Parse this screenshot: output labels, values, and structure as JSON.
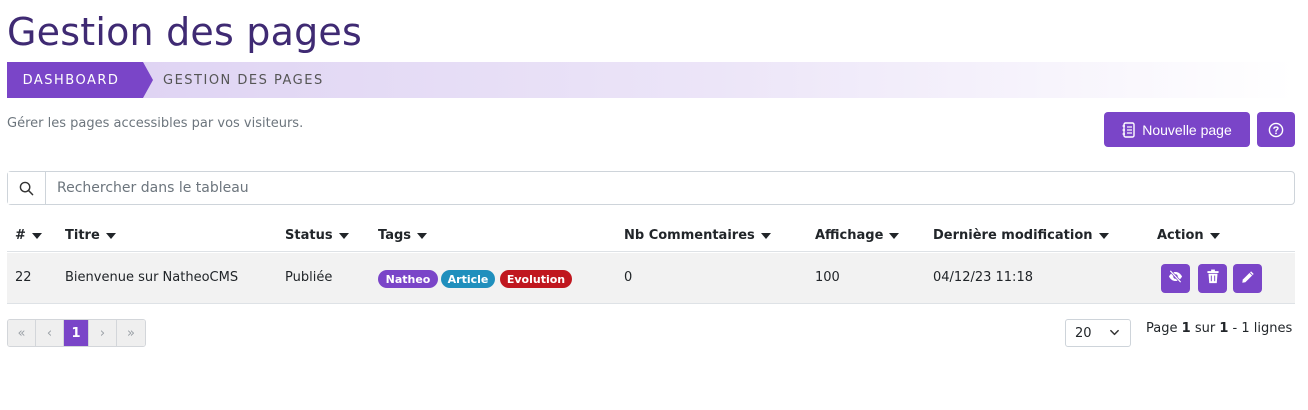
{
  "page": {
    "title": "Gestion des pages",
    "subtitle": "Gérer les pages accessibles par vos visiteurs."
  },
  "breadcrumb": {
    "items": [
      {
        "label": "Dashboard"
      },
      {
        "label": "Gestion des pages"
      }
    ]
  },
  "toolbar": {
    "new_page_label": "Nouvelle page",
    "new_page_icon": "journal-plus-icon",
    "help_icon": "question-circle-icon"
  },
  "search": {
    "placeholder": "Rechercher dans le tableau",
    "value": ""
  },
  "table": {
    "columns": [
      {
        "label": "#"
      },
      {
        "label": "Titre"
      },
      {
        "label": "Status"
      },
      {
        "label": "Tags"
      },
      {
        "label": "Nb Commentaires"
      },
      {
        "label": "Affichage"
      },
      {
        "label": "Dernière modification"
      },
      {
        "label": "Action"
      }
    ],
    "rows": [
      {
        "id": "22",
        "title": "Bienvenue sur NatheoCMS",
        "status": "Publiée",
        "tags": [
          {
            "label": "Natheo",
            "color": "#7a45c8"
          },
          {
            "label": "Article",
            "color": "#1f8fbd"
          },
          {
            "label": "Evolution",
            "color": "#c0171f"
          }
        ],
        "comments": "0",
        "views": "100",
        "modified": "04/12/23 11:18",
        "actions": [
          "eye-slash-icon",
          "trash-icon",
          "pencil-icon"
        ]
      }
    ]
  },
  "pagination": {
    "first": "«",
    "prev": "‹",
    "current": "1",
    "next": "›",
    "last": "»",
    "per_page": "20",
    "info": {
      "prefix": "Page",
      "page": "1",
      "sep": "sur",
      "total_pages": "1",
      "dash": "-",
      "lines": "1 lignes"
    }
  },
  "colors": {
    "accent": "#7a45c8",
    "title": "#3f2a73"
  }
}
